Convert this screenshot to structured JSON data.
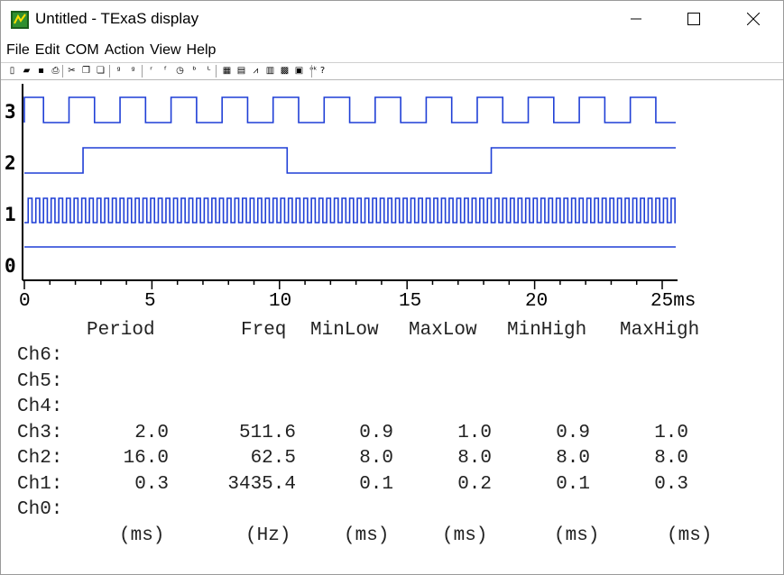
{
  "window": {
    "title": "Untitled - TExaS display"
  },
  "menu": [
    "File",
    "Edit",
    "COM",
    "Action",
    "View",
    "Help"
  ],
  "toolbar_icons": [
    "new-file-icon",
    "open-folder-icon",
    "save-icon",
    "print-icon",
    "cut-icon",
    "copy-icon",
    "paste-icon",
    "grab-icon",
    "grab-repeat-icon",
    "trigger-rise-icon",
    "trigger-fall-icon",
    "clock-icon",
    "trigger-both-icon",
    "trigger-level-icon",
    "scope-icon",
    "logic-icon",
    "spectrum-icon",
    "histogram-icon",
    "stats-icon",
    "digital-icon",
    "ok-icon",
    "help-icon"
  ],
  "chart_data": {
    "type": "line",
    "xlabel_unit": "ms",
    "xlim": [
      0,
      25
    ],
    "xticks": [
      "0",
      "5",
      "10",
      "15",
      "20",
      "25ms"
    ],
    "channels": [
      "3",
      "2",
      "1",
      "0"
    ],
    "series": [
      {
        "channel": "3",
        "period_ms": 2.0,
        "note": "square wave"
      },
      {
        "channel": "2",
        "period_ms": 16.0,
        "edges_ms": [
          2.3,
          10.3,
          18.3
        ],
        "initial": "low"
      },
      {
        "channel": "1",
        "period_ms": 0.3,
        "note": "fast square wave"
      },
      {
        "channel": "0",
        "constant": "low"
      }
    ]
  },
  "stats": {
    "headers": [
      "Period",
      "Freq",
      "MinLow",
      "MaxLow",
      "MinHigh",
      "MaxHigh"
    ],
    "rows": [
      {
        "label": "Ch6:",
        "values": [
          "",
          "",
          "",
          "",
          "",
          ""
        ]
      },
      {
        "label": "Ch5:",
        "values": [
          "",
          "",
          "",
          "",
          "",
          ""
        ]
      },
      {
        "label": "Ch4:",
        "values": [
          "",
          "",
          "",
          "",
          "",
          ""
        ]
      },
      {
        "label": "Ch3:",
        "values": [
          "2.0",
          "511.6",
          "0.9",
          "1.0",
          "0.9",
          "1.0"
        ]
      },
      {
        "label": "Ch2:",
        "values": [
          "16.0",
          "62.5",
          "8.0",
          "8.0",
          "8.0",
          "8.0"
        ]
      },
      {
        "label": "Ch1:",
        "values": [
          "0.3",
          "3435.4",
          "0.1",
          "0.2",
          "0.1",
          "0.3"
        ]
      },
      {
        "label": "Ch0:",
        "values": [
          "",
          "",
          "",
          "",
          "",
          ""
        ]
      }
    ],
    "units": [
      "(ms)",
      "(Hz)",
      "(ms)",
      "(ms)",
      "(ms)",
      "(ms)"
    ]
  },
  "colors": {
    "trace": "#1f3fd6",
    "axis": "#000000"
  }
}
